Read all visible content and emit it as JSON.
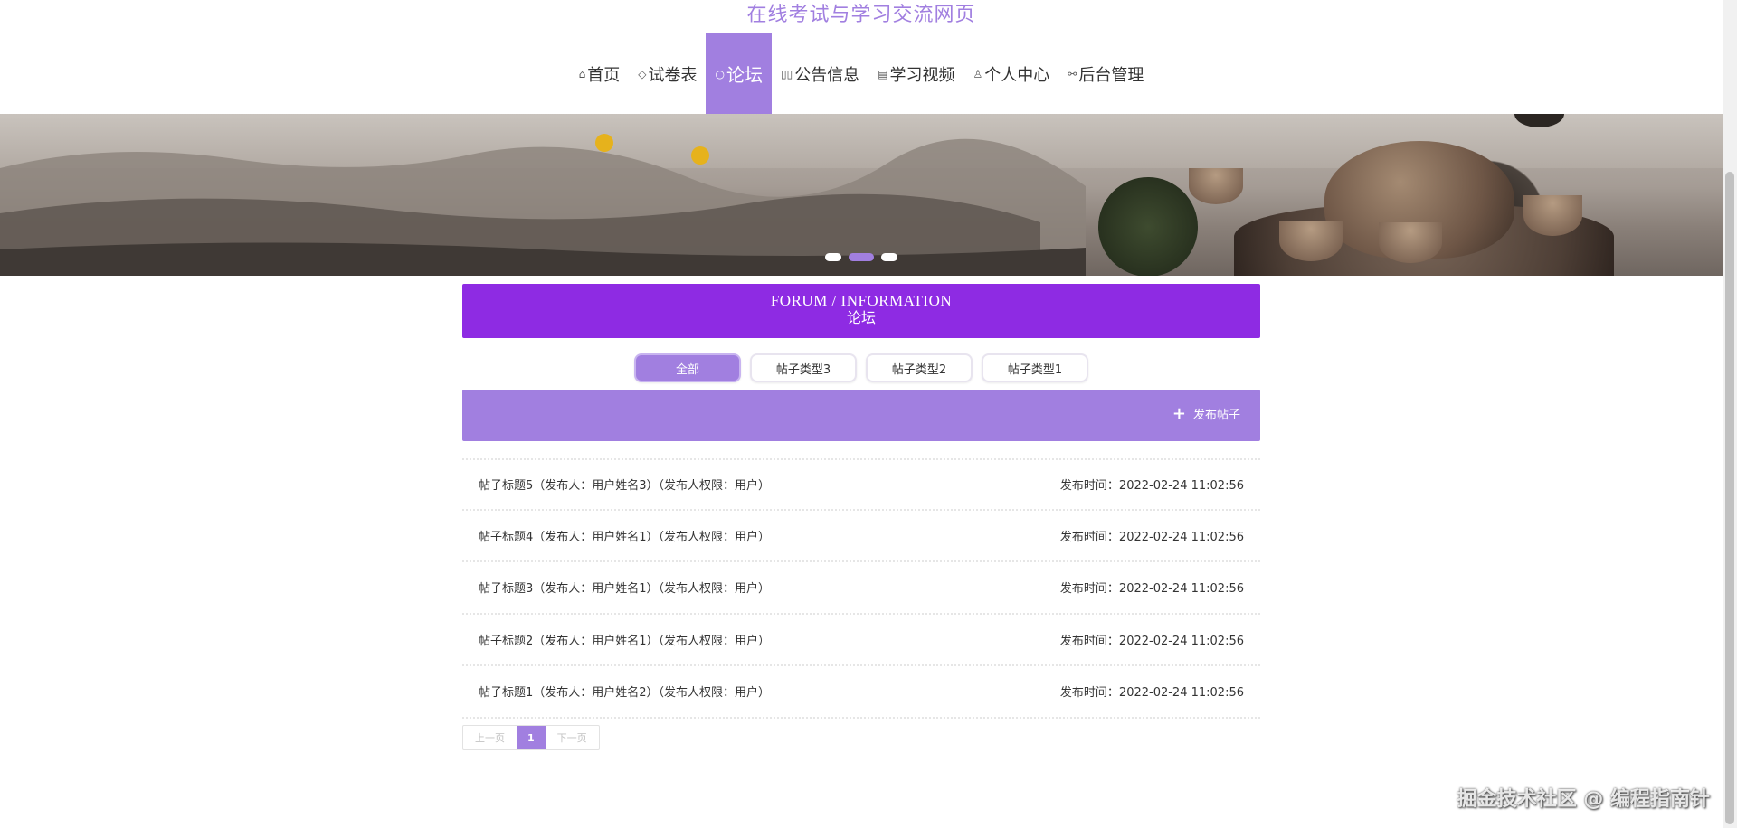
{
  "site": {
    "title": "在线考试与学习交流网页"
  },
  "nav": {
    "items": [
      {
        "icon": "home-icon",
        "glyph": "⌂",
        "label": "首页"
      },
      {
        "icon": "tag-icon",
        "glyph": "◇",
        "label": "试卷表"
      },
      {
        "icon": "chat-icon",
        "glyph": "○",
        "label": "论坛",
        "active": true
      },
      {
        "icon": "notice-icon",
        "glyph": "▯▯",
        "label": "公告信息"
      },
      {
        "icon": "video-icon",
        "glyph": "▤",
        "label": "学习视频"
      },
      {
        "icon": "user-icon",
        "glyph": "♙",
        "label": "个人中心"
      },
      {
        "icon": "link-icon",
        "glyph": "⚯",
        "label": "后台管理"
      }
    ]
  },
  "section": {
    "title_en": "FORUM / INFORMATION",
    "title_cn": "论坛"
  },
  "tabs": [
    {
      "label": "全部",
      "active": true
    },
    {
      "label": "帖子类型3"
    },
    {
      "label": "帖子类型2"
    },
    {
      "label": "帖子类型1"
    }
  ],
  "actions": {
    "publish_label": "发布帖子",
    "plus": "+"
  },
  "posts": [
    {
      "title": "帖子标题5（发布人：用户姓名3）（发布人权限：用户）",
      "time": "发布时间：2022-02-24 11:02:56"
    },
    {
      "title": "帖子标题4（发布人：用户姓名1）（发布人权限：用户）",
      "time": "发布时间：2022-02-24 11:02:56"
    },
    {
      "title": "帖子标题3（发布人：用户姓名1）（发布人权限：用户）",
      "time": "发布时间：2022-02-24 11:02:56"
    },
    {
      "title": "帖子标题2（发布人：用户姓名1）（发布人权限：用户）",
      "time": "发布时间：2022-02-24 11:02:56"
    },
    {
      "title": "帖子标题1（发布人：用户姓名2）（发布人权限：用户）",
      "time": "发布时间：2022-02-24 11:02:56"
    }
  ],
  "pager": {
    "prev": "上一页",
    "current": "1",
    "next": "下一页"
  },
  "watermark": "掘金技术社区 @ 编程指南针",
  "colors": {
    "accent": "#a17fe0",
    "header": "#8e2be3"
  }
}
